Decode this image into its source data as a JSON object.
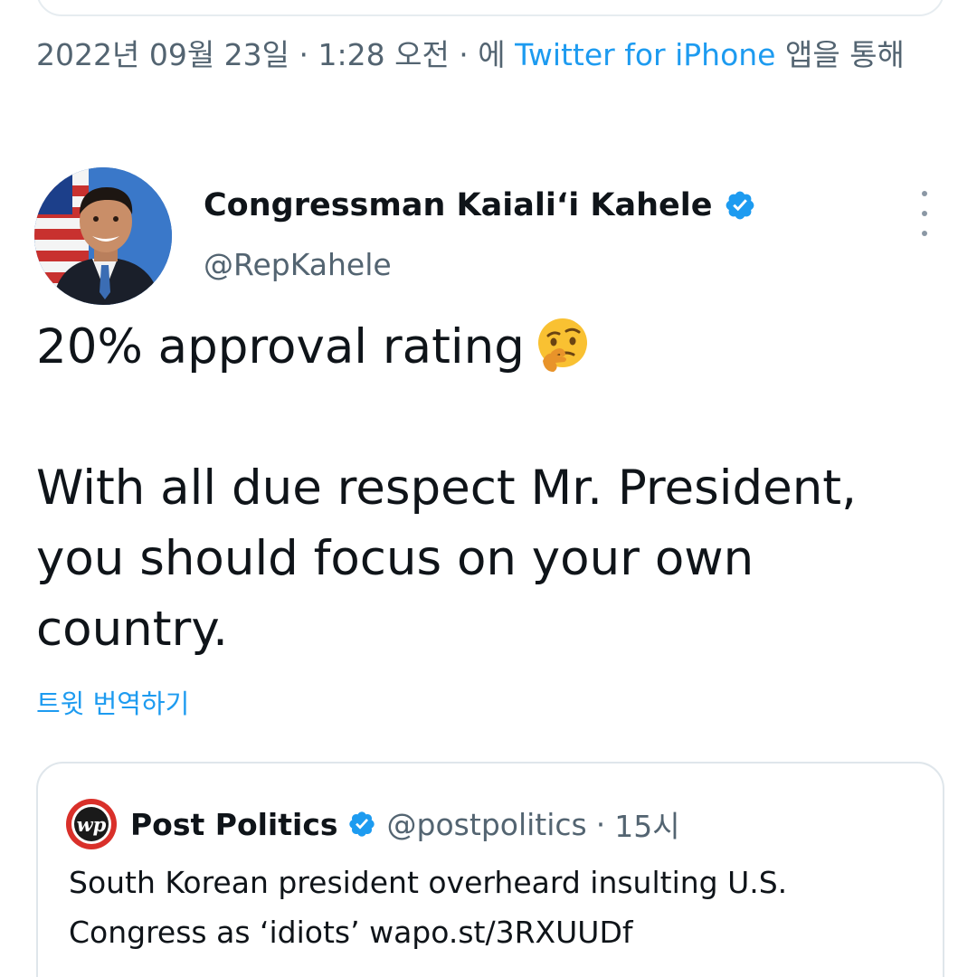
{
  "meta": {
    "timestamp": "2022년 09월 23일 · 1:28 오전 · ",
    "via_prefix": "에 ",
    "source": "Twitter for iPhone",
    "via_suffix": " 앱을 통해"
  },
  "author": {
    "name": "Congressman Kaiali‘i Kahele",
    "handle": "@RepKahele",
    "verified_icon": "verified-badge-icon"
  },
  "tweet": {
    "line1": "20% approval rating",
    "emoji_icon": "thinking-face-emoji",
    "paragraph2": "With all due respect Mr. President,\nyou should focus on your own\ncountry."
  },
  "translate_link": "트윗 번역하기",
  "quote": {
    "logo_icon": "washington-post-logo",
    "name": "Post Politics",
    "handle": "@postpolitics",
    "separator": "·",
    "time": "15시",
    "text": "South Korean president overheard insulting U.S. Congress as ‘idiots’ wapo.st/3RXUUDf"
  },
  "colors": {
    "link": "#1d9bf0",
    "secondary_text": "#536471",
    "primary_text": "#0f1419",
    "border": "#dfe6eb"
  }
}
